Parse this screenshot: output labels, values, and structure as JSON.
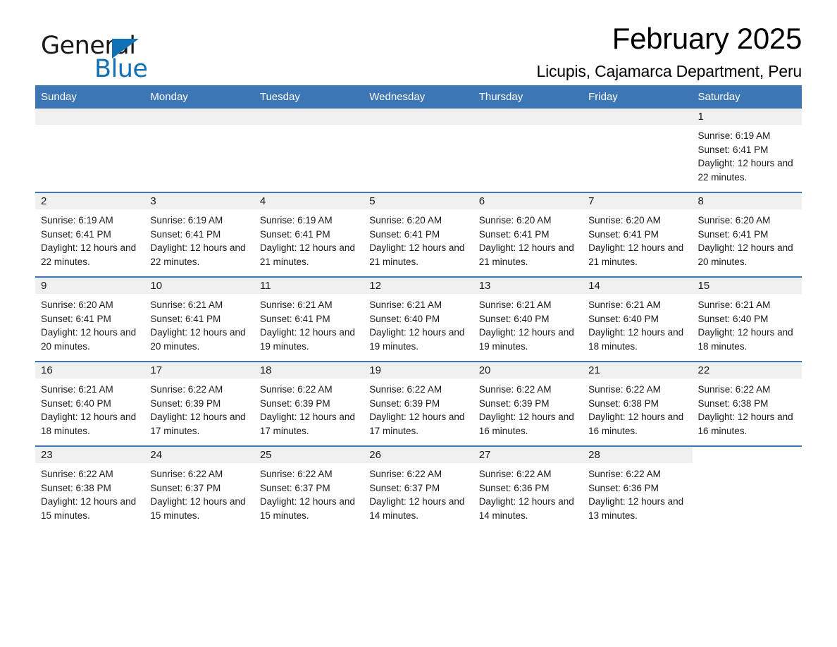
{
  "brand": {
    "name_part1": "General",
    "name_part2": "Blue",
    "accent_color": "#1271b5"
  },
  "header": {
    "title": "February 2025",
    "subtitle": "Licupis, Cajamarca Department, Peru"
  },
  "theme": {
    "header_blue": "#3d76b4",
    "day_band_gray": "#f0f0f0"
  },
  "weekday_headers": [
    "Sunday",
    "Monday",
    "Tuesday",
    "Wednesday",
    "Thursday",
    "Friday",
    "Saturday"
  ],
  "labels": {
    "sunrise_prefix": "Sunrise:",
    "sunset_prefix": "Sunset:",
    "daylight_prefix": "Daylight:"
  },
  "weeks": [
    [
      {
        "day": "",
        "empty": true
      },
      {
        "day": "",
        "empty": true
      },
      {
        "day": "",
        "empty": true
      },
      {
        "day": "",
        "empty": true
      },
      {
        "day": "",
        "empty": true
      },
      {
        "day": "",
        "empty": true
      },
      {
        "day": "1",
        "sunrise": "Sunrise: 6:19 AM",
        "sunset": "Sunset: 6:41 PM",
        "daylight": "Daylight: 12 hours and 22 minutes."
      }
    ],
    [
      {
        "day": "2",
        "sunrise": "Sunrise: 6:19 AM",
        "sunset": "Sunset: 6:41 PM",
        "daylight": "Daylight: 12 hours and 22 minutes."
      },
      {
        "day": "3",
        "sunrise": "Sunrise: 6:19 AM",
        "sunset": "Sunset: 6:41 PM",
        "daylight": "Daylight: 12 hours and 22 minutes."
      },
      {
        "day": "4",
        "sunrise": "Sunrise: 6:19 AM",
        "sunset": "Sunset: 6:41 PM",
        "daylight": "Daylight: 12 hours and 21 minutes."
      },
      {
        "day": "5",
        "sunrise": "Sunrise: 6:20 AM",
        "sunset": "Sunset: 6:41 PM",
        "daylight": "Daylight: 12 hours and 21 minutes."
      },
      {
        "day": "6",
        "sunrise": "Sunrise: 6:20 AM",
        "sunset": "Sunset: 6:41 PM",
        "daylight": "Daylight: 12 hours and 21 minutes."
      },
      {
        "day": "7",
        "sunrise": "Sunrise: 6:20 AM",
        "sunset": "Sunset: 6:41 PM",
        "daylight": "Daylight: 12 hours and 21 minutes."
      },
      {
        "day": "8",
        "sunrise": "Sunrise: 6:20 AM",
        "sunset": "Sunset: 6:41 PM",
        "daylight": "Daylight: 12 hours and 20 minutes."
      }
    ],
    [
      {
        "day": "9",
        "sunrise": "Sunrise: 6:20 AM",
        "sunset": "Sunset: 6:41 PM",
        "daylight": "Daylight: 12 hours and 20 minutes."
      },
      {
        "day": "10",
        "sunrise": "Sunrise: 6:21 AM",
        "sunset": "Sunset: 6:41 PM",
        "daylight": "Daylight: 12 hours and 20 minutes."
      },
      {
        "day": "11",
        "sunrise": "Sunrise: 6:21 AM",
        "sunset": "Sunset: 6:41 PM",
        "daylight": "Daylight: 12 hours and 19 minutes."
      },
      {
        "day": "12",
        "sunrise": "Sunrise: 6:21 AM",
        "sunset": "Sunset: 6:40 PM",
        "daylight": "Daylight: 12 hours and 19 minutes."
      },
      {
        "day": "13",
        "sunrise": "Sunrise: 6:21 AM",
        "sunset": "Sunset: 6:40 PM",
        "daylight": "Daylight: 12 hours and 19 minutes."
      },
      {
        "day": "14",
        "sunrise": "Sunrise: 6:21 AM",
        "sunset": "Sunset: 6:40 PM",
        "daylight": "Daylight: 12 hours and 18 minutes."
      },
      {
        "day": "15",
        "sunrise": "Sunrise: 6:21 AM",
        "sunset": "Sunset: 6:40 PM",
        "daylight": "Daylight: 12 hours and 18 minutes."
      }
    ],
    [
      {
        "day": "16",
        "sunrise": "Sunrise: 6:21 AM",
        "sunset": "Sunset: 6:40 PM",
        "daylight": "Daylight: 12 hours and 18 minutes."
      },
      {
        "day": "17",
        "sunrise": "Sunrise: 6:22 AM",
        "sunset": "Sunset: 6:39 PM",
        "daylight": "Daylight: 12 hours and 17 minutes."
      },
      {
        "day": "18",
        "sunrise": "Sunrise: 6:22 AM",
        "sunset": "Sunset: 6:39 PM",
        "daylight": "Daylight: 12 hours and 17 minutes."
      },
      {
        "day": "19",
        "sunrise": "Sunrise: 6:22 AM",
        "sunset": "Sunset: 6:39 PM",
        "daylight": "Daylight: 12 hours and 17 minutes."
      },
      {
        "day": "20",
        "sunrise": "Sunrise: 6:22 AM",
        "sunset": "Sunset: 6:39 PM",
        "daylight": "Daylight: 12 hours and 16 minutes."
      },
      {
        "day": "21",
        "sunrise": "Sunrise: 6:22 AM",
        "sunset": "Sunset: 6:38 PM",
        "daylight": "Daylight: 12 hours and 16 minutes."
      },
      {
        "day": "22",
        "sunrise": "Sunrise: 6:22 AM",
        "sunset": "Sunset: 6:38 PM",
        "daylight": "Daylight: 12 hours and 16 minutes."
      }
    ],
    [
      {
        "day": "23",
        "sunrise": "Sunrise: 6:22 AM",
        "sunset": "Sunset: 6:38 PM",
        "daylight": "Daylight: 12 hours and 15 minutes."
      },
      {
        "day": "24",
        "sunrise": "Sunrise: 6:22 AM",
        "sunset": "Sunset: 6:37 PM",
        "daylight": "Daylight: 12 hours and 15 minutes."
      },
      {
        "day": "25",
        "sunrise": "Sunrise: 6:22 AM",
        "sunset": "Sunset: 6:37 PM",
        "daylight": "Daylight: 12 hours and 15 minutes."
      },
      {
        "day": "26",
        "sunrise": "Sunrise: 6:22 AM",
        "sunset": "Sunset: 6:37 PM",
        "daylight": "Daylight: 12 hours and 14 minutes."
      },
      {
        "day": "27",
        "sunrise": "Sunrise: 6:22 AM",
        "sunset": "Sunset: 6:36 PM",
        "daylight": "Daylight: 12 hours and 14 minutes."
      },
      {
        "day": "28",
        "sunrise": "Sunrise: 6:22 AM",
        "sunset": "Sunset: 6:36 PM",
        "daylight": "Daylight: 12 hours and 13 minutes."
      },
      {
        "day": "",
        "empty": true,
        "blank": true
      }
    ]
  ]
}
